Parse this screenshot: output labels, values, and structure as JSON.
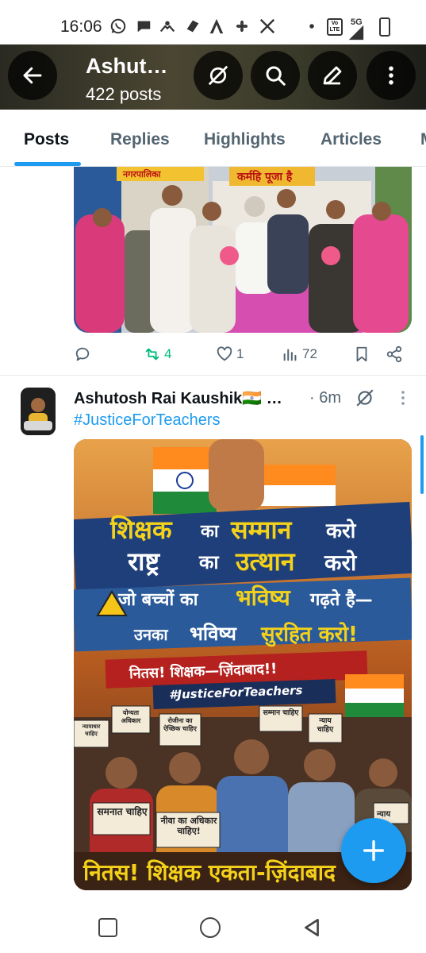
{
  "status_bar": {
    "time": "16:06",
    "network": "5G",
    "volte_label": "Vo LTE",
    "icons": [
      "whatsapp-icon",
      "chat-icon",
      "app-icon",
      "app-icon",
      "text-a-icon",
      "pinwheel-icon",
      "x-icon",
      "dot-icon"
    ]
  },
  "header": {
    "title": "Ashut…",
    "subtitle": "422 posts"
  },
  "tabs": [
    "Posts",
    "Replies",
    "Highlights",
    "Articles",
    "M"
  ],
  "post1": {
    "banner_left": "नगरपालिका",
    "banner_right": "कर्महि पूजा है",
    "actions": {
      "reply_count": "",
      "repost_count": "4",
      "like_count": "1",
      "views_count": "72"
    }
  },
  "post2": {
    "author_name": "Ashutosh Rai Kaushik🇮🇳 …",
    "time": "· 6m",
    "hashtag": "#JusticeForTeachers",
    "poster": {
      "line1a": "शिक्षक",
      "line1b": "का",
      "line1c": "सम्मान",
      "line1d": "करो",
      "line2a": "राष्ट्र",
      "line2b": "का",
      "line2c": "उत्थान",
      "line2d": "करो",
      "line3a": "जो बच्चों का",
      "line3b": "भविष्य",
      "line3c": "गढ़ते है—",
      "line4a": "उनका",
      "line4b": "भविष्य",
      "line4c": "सुरहित करो!",
      "line5": "नितस! शिक्षक—ज़िंदाबाद!!",
      "line6": "#JusticeForTeachers",
      "sign1": "समनात चाहिए",
      "sign2": "नीवा का अधिकार चाहिए!",
      "sign3": "सम्मान चाहिए",
      "sign4": "न्याय चाहिए",
      "sign5": "योग्यता अधिकार",
      "sign6": "रोजीना का ऐच्छिक चाहिए",
      "sign7": "न्याय",
      "sign8": "न्यायाधार चाहिए",
      "bottom": "नितस! शिक्षक एकता-ज़िंदाबाद"
    }
  },
  "colors": {
    "accent": "#1d9bf0",
    "repost_green": "#00ba7c",
    "muted": "#536471"
  }
}
